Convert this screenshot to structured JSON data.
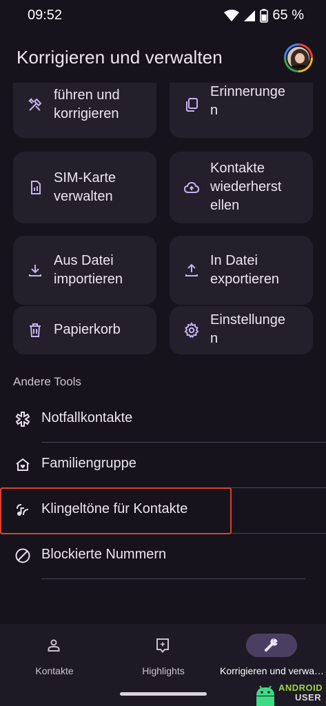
{
  "status_bar": {
    "time": "09:52",
    "battery": "65 %"
  },
  "header": {
    "title": "Korrigieren und verwalten"
  },
  "tiles": [
    {
      "label": "Zusammen\nführen und\nkorrigieren",
      "icon": "merge-tools-icon"
    },
    {
      "label": "Erinnerunge\nn",
      "icon": "copy-reminders-icon"
    },
    {
      "label": "SIM-Karte\nverwalten",
      "icon": "sim-card-icon"
    },
    {
      "label": "Kontakte\nwiederherst\nellen",
      "icon": "cloud-restore-icon"
    },
    {
      "label": "Aus Datei\nimportieren",
      "icon": "download-icon"
    },
    {
      "label": "In Datei\nexportieren",
      "icon": "upload-icon"
    },
    {
      "label": "Papierkorb",
      "icon": "trash-icon"
    },
    {
      "label": "Einstellunge\nn",
      "icon": "settings-gear-icon"
    }
  ],
  "other_tools": {
    "header": "Andere Tools",
    "items": [
      {
        "label": "Notfallkontakte",
        "icon": "emergency-asterisk-icon"
      },
      {
        "label": "Familiengruppe",
        "icon": "family-home-icon"
      },
      {
        "label": "Klingeltöne für Kontakte",
        "icon": "ringtone-icon"
      },
      {
        "label": "Blockierte Nummern",
        "icon": "block-icon"
      }
    ]
  },
  "bottom_nav": [
    {
      "label": "Kontakte",
      "icon": "person-icon",
      "active": false
    },
    {
      "label": "Highlights",
      "icon": "highlights-icon",
      "active": false
    },
    {
      "label": "Korrigieren und verwa…",
      "icon": "wrench-icon",
      "active": true
    }
  ],
  "watermark": {
    "line1": "ANDROID",
    "line2": "USER"
  },
  "colors": {
    "accent": "#c5b5f0",
    "active_pill": "#4a3f63",
    "highlight_box": "#d9432e",
    "background": "#16131d",
    "tile": "#231f2b"
  }
}
